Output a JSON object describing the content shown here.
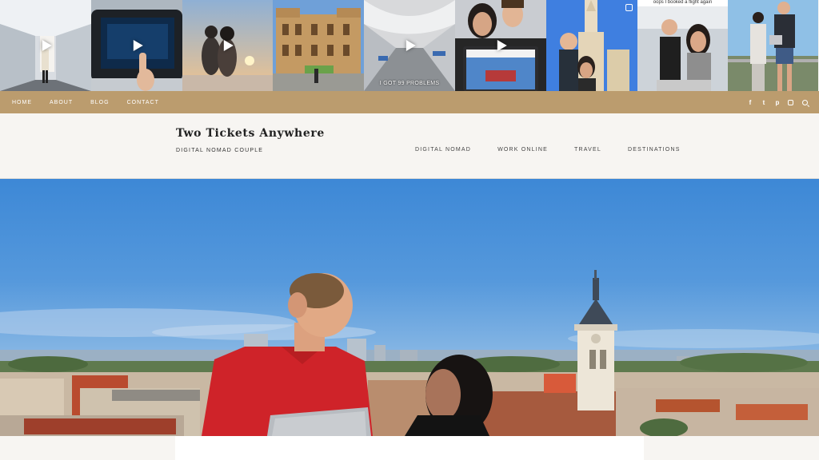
{
  "instagram": {
    "tiles": [
      {
        "desc": "airport-walkway",
        "play": true,
        "caption": ""
      },
      {
        "desc": "in-flight-screen",
        "play": true,
        "caption": ""
      },
      {
        "desc": "couple-sunset",
        "play": true,
        "caption": ""
      },
      {
        "desc": "ornate-building",
        "play": false,
        "caption": ""
      },
      {
        "desc": "train-station",
        "play": true,
        "caption": "I GOT 99 PROBLEMS"
      },
      {
        "desc": "couple-laptop",
        "play": true,
        "caption": ""
      },
      {
        "desc": "couple-cathedral",
        "play": false,
        "caption": ""
      },
      {
        "desc": "couple-selfie",
        "play": false,
        "caption": "oops I booked a flight again"
      },
      {
        "desc": "couple-rooftop-laptops",
        "play": false,
        "caption": ""
      }
    ]
  },
  "topnav": {
    "items": [
      "HOME",
      "ABOUT",
      "BLOG",
      "CONTACT"
    ]
  },
  "social": {
    "icons": [
      "facebook-icon",
      "twitter-icon",
      "pinterest-icon",
      "instagram-icon",
      "search-icon"
    ],
    "facebook": "f",
    "twitter": "t",
    "pinterest": "p"
  },
  "header": {
    "title": "Two Tickets Anywhere",
    "tagline": "DIGITAL NOMAD COUPLE"
  },
  "mainnav": {
    "items": [
      "DIGITAL NOMAD",
      "WORK ONLINE",
      "TRAVEL",
      "DESTINATIONS"
    ]
  },
  "colors": {
    "nav_bar": "#bb9c6e",
    "page_bg": "#f7f5f2",
    "sky": "#4a90d9"
  }
}
